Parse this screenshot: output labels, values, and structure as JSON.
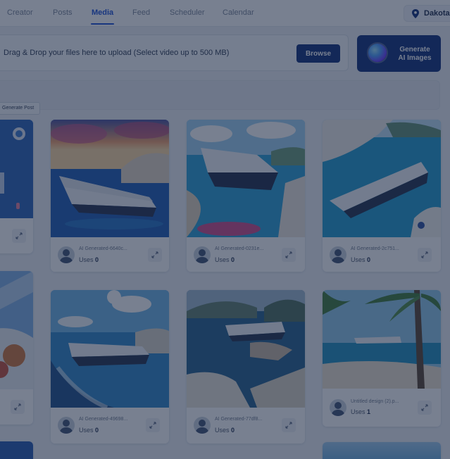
{
  "nav": {
    "tabs": [
      "Creator",
      "Posts",
      "Media",
      "Feed",
      "Scheduler",
      "Calendar"
    ],
    "active": "Media",
    "location": "Dakota I"
  },
  "upload": {
    "instruction": "Drag & Drop your files here to upload (Select video up to 500 MB)",
    "browse_label": "Browse"
  },
  "generate_ai": {
    "line1": "Generate",
    "line2": "AI Images"
  },
  "tooltip": "Generate Post",
  "cards": [
    {
      "name": "AI Generated-6640c...",
      "uses_label": "Uses",
      "uses": "0"
    },
    {
      "name": "AI Generated-0231e...",
      "uses_label": "Uses",
      "uses": "0"
    },
    {
      "name": "AI Generated-2c751...",
      "uses_label": "Uses",
      "uses": "0"
    },
    {
      "name": "AI Generated-49698...",
      "uses_label": "Uses",
      "uses": "0"
    },
    {
      "name": "AI Generated-77df8...",
      "uses_label": "Uses",
      "uses": "0"
    },
    {
      "name": "Untitled design (2).p...",
      "uses_label": "Uses",
      "uses": "1"
    }
  ],
  "colors": {
    "accent": "#1c4fd6",
    "primary_button": "#0f2e7a",
    "overlay": "#162440"
  }
}
